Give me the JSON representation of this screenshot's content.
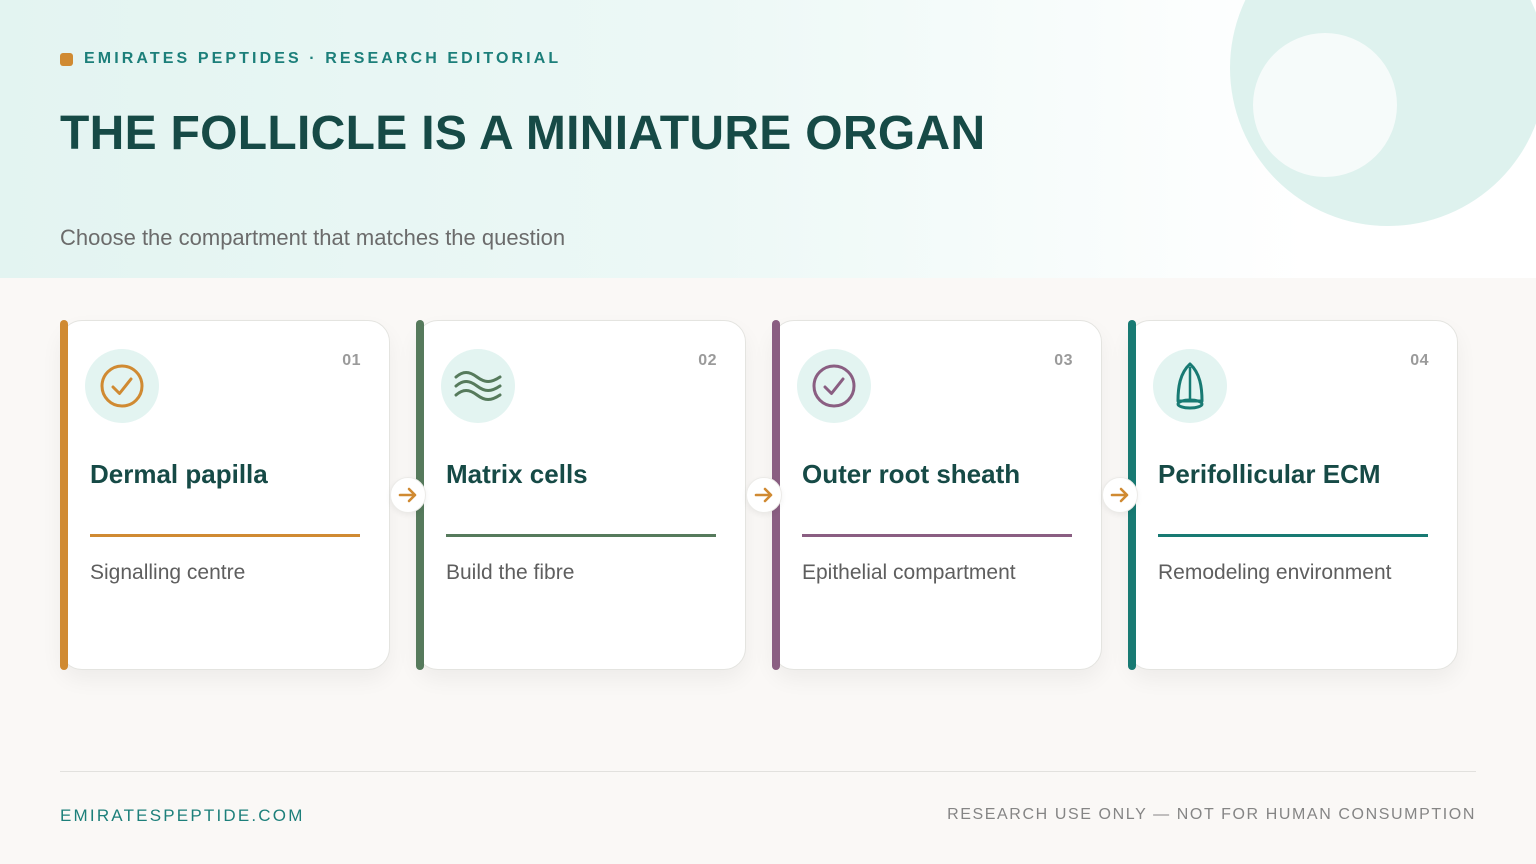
{
  "header": {
    "kicker": "EMIRATES PEPTIDES · RESEARCH EDITORIAL",
    "title": "THE FOLLICLE IS A MINIATURE ORGAN",
    "subtitle": "Choose the compartment that matches the question"
  },
  "cards": [
    {
      "number": "01",
      "title": "Dermal papilla",
      "description": "Signalling centre",
      "color": "#d08a32",
      "icon": "check-circle-icon"
    },
    {
      "number": "02",
      "title": "Matrix cells",
      "description": "Build the fibre",
      "color": "#567a5c",
      "icon": "waves-icon"
    },
    {
      "number": "03",
      "title": "Outer root sheath",
      "description": "Epithelial compartment",
      "color": "#8a5e82",
      "icon": "check-circle-icon"
    },
    {
      "number": "04",
      "title": "Perifollicular ECM",
      "description": "Remodeling environment",
      "color": "#187a73",
      "icon": "follicle-bulb-icon"
    }
  ],
  "connectors": {
    "icon": "arrow-right-icon",
    "color": "#d08a32"
  },
  "footer": {
    "website": "EMIRATESPEPTIDE.COM",
    "disclaimer": "RESEARCH USE ONLY — NOT FOR HUMAN CONSUMPTION"
  },
  "colors": {
    "brand_teal": "#1c7f7a",
    "title_green": "#164a46",
    "accent_orange": "#d08a32",
    "hero_tint": "#e3f4f1"
  }
}
